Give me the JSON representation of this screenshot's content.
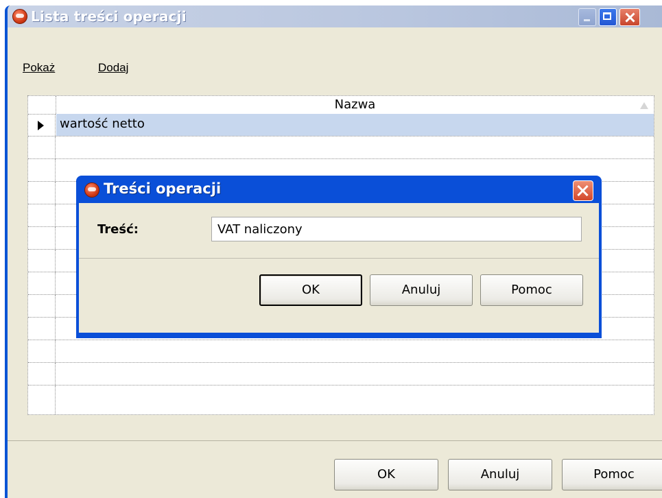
{
  "main_window": {
    "title": "Lista treści operacji",
    "menu": [
      "Pokaż",
      "Dodaj"
    ],
    "grid": {
      "column_header": "Nazwa",
      "rows": [
        "wartość netto"
      ]
    },
    "buttons": {
      "ok": "OK",
      "cancel": "Anuluj",
      "help": "Pomoc"
    }
  },
  "dialog": {
    "title": "Treści operacji",
    "field_label": "Treść:",
    "field_value": "VAT naliczony",
    "buttons": {
      "ok": "OK",
      "cancel": "Anuluj",
      "help": "Pomoc"
    }
  },
  "colors": {
    "dialog_frame": "#0a4fd8",
    "selected_row": "#c7d7ee",
    "window_face": "#ece9d8"
  }
}
